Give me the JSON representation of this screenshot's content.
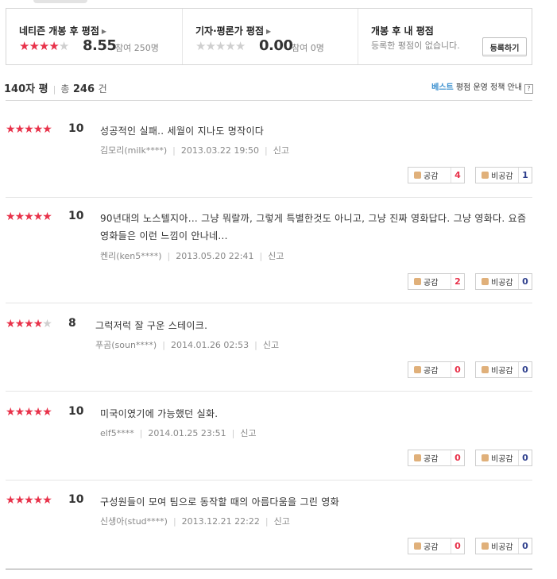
{
  "summary": {
    "netizen": {
      "title": "네티즌 개봉 후 평점",
      "stars": 4,
      "score": "8.55",
      "count": "참여 250명"
    },
    "critic": {
      "title": "기자·평론가 평점",
      "stars": 0,
      "score": "0.00",
      "count": "참여 0명"
    },
    "mine": {
      "title": "개봉 후 내 평점",
      "empty": "등록한 평점이 없습니다.",
      "button": "등록하기"
    }
  },
  "list_header": {
    "title": "140자 평",
    "total_label": "총",
    "total": "246",
    "unit": "건",
    "policy_best": "베스트",
    "policy_text": "평점 운영 정책 안내",
    "help": "?"
  },
  "reviews": [
    {
      "stars": 5,
      "score": "10",
      "text": "성공적인 실패.. 세월이 지나도 명작이다",
      "user": "김모리(milk****)",
      "date": "2013.03.22 19:50",
      "report": "신고",
      "like_label": "공감",
      "like": "4",
      "dislike_label": "비공감",
      "dislike": "1"
    },
    {
      "stars": 5,
      "score": "10",
      "text": "90년대의 노스텔지아... 그냥 뭐랄까, 그렇게 특별한것도 아니고, 그냥 진짜 영화답다. 그냥 영화다. 요즘 영화들은 이런 느낌이 안나네...",
      "user": "켄리(ken5****)",
      "date": "2013.05.20 22:41",
      "report": "신고",
      "like_label": "공감",
      "like": "2",
      "dislike_label": "비공감",
      "dislike": "0"
    },
    {
      "stars": 4,
      "score": "8",
      "text": "그럭저럭 잘 구운 스테이크.",
      "user": "푸곰(soun****)",
      "date": "2014.01.26 02:53",
      "report": "신고",
      "like_label": "공감",
      "like": "0",
      "dislike_label": "비공감",
      "dislike": "0"
    },
    {
      "stars": 5,
      "score": "10",
      "text": "미국이였기에 가능했던 실화.",
      "user": "elf5****",
      "date": "2014.01.25 23:51",
      "report": "신고",
      "like_label": "공감",
      "like": "0",
      "dislike_label": "비공감",
      "dislike": "0"
    },
    {
      "stars": 5,
      "score": "10",
      "text": "구성원들이 모여 팀으로 동작할 때의 아름다움을 그린 영화",
      "user": "신생아(stud****)",
      "date": "2013.12.21 22:22",
      "report": "신고",
      "like_label": "공감",
      "like": "0",
      "dislike_label": "비공감",
      "dislike": "0"
    }
  ],
  "colors": {
    "star_on": "#e8324a",
    "star_off": "#cfcfcf",
    "like_count": "#e8324a",
    "dislike_count": "#2d3e8c",
    "best": "#3a8fcf"
  },
  "icons": {
    "like": "thumbs-up-icon",
    "dislike": "thumbs-down-icon"
  }
}
